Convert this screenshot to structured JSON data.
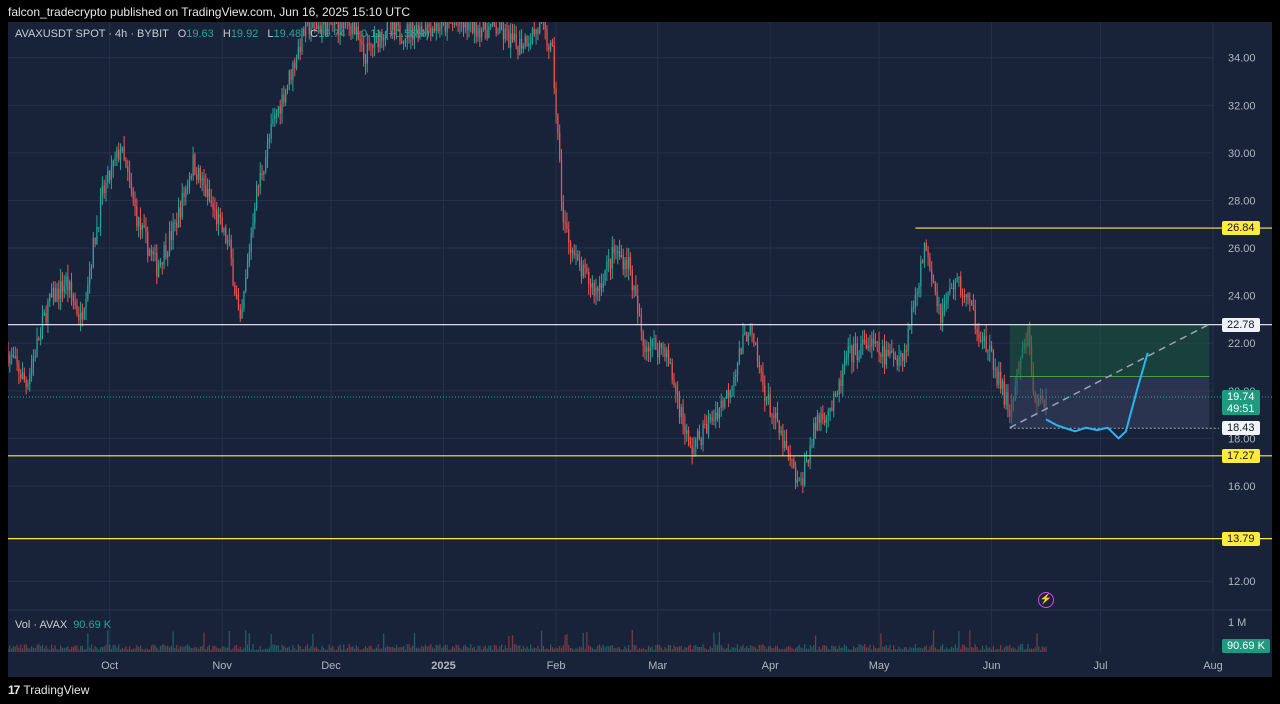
{
  "header": {
    "publisher_line": "falcon_tradecrypto published on TradingView.com, Jun 16, 2025 15:10 UTC"
  },
  "legend": {
    "symbol": "AVAXUSDT SPOT · 4h · BYBIT",
    "open_label": "O",
    "open": "19.63",
    "high_label": "H",
    "high": "19.92",
    "low_label": "L",
    "low": "19.48",
    "close_label": "C",
    "close": "19.74",
    "change": "+0.11 (+0.56%)"
  },
  "volume_legend": {
    "label": "Vol · AVAX",
    "value": "90.69 K",
    "axis_label": "1 M",
    "tag": "90.69 K"
  },
  "footer": {
    "brand": "TradingView",
    "logo": "17"
  },
  "colors": {
    "background": "#18233a",
    "grid": "#25314a",
    "bull": "#26a69a",
    "bear": "#ef5350",
    "level_yellow": "#ffeb3b",
    "level_white": "#f0f3fa",
    "projection": "#29b6f6",
    "target_zone": "#1e5a3f",
    "stop_zone": "#3b4460"
  },
  "chart_data": {
    "type": "candlestick",
    "symbol": "AVAXUSDT",
    "timeframe": "4h",
    "y_axis": {
      "ticks": [
        "12.00",
        "16.00",
        "18.00",
        "20.00",
        "22.00",
        "24.00",
        "26.00",
        "28.00",
        "30.00",
        "32.00",
        "34.00"
      ],
      "ylim": [
        11,
        35.5
      ]
    },
    "x_axis": {
      "ticks": [
        {
          "label": "Oct",
          "date": "2024-10-01"
        },
        {
          "label": "Nov",
          "date": "2024-11-01"
        },
        {
          "label": "Dec",
          "date": "2024-12-01"
        },
        {
          "label": "2025",
          "date": "2025-01-01"
        },
        {
          "label": "Feb",
          "date": "2025-02-01"
        },
        {
          "label": "Mar",
          "date": "2025-03-01"
        },
        {
          "label": "Apr",
          "date": "2025-04-01"
        },
        {
          "label": "May",
          "date": "2025-05-01"
        },
        {
          "label": "Jun",
          "date": "2025-06-01"
        },
        {
          "label": "Jul",
          "date": "2025-07-01"
        },
        {
          "label": "Aug",
          "date": "2025-08-01"
        }
      ],
      "xlim": [
        "2024-09-03",
        "2025-08-01"
      ]
    },
    "price_path": [
      {
        "date": "2024-09-03",
        "price": 21.6
      },
      {
        "date": "2024-09-08",
        "price": 20.3
      },
      {
        "date": "2024-09-14",
        "price": 23.6
      },
      {
        "date": "2024-09-19",
        "price": 24.6
      },
      {
        "date": "2024-09-23",
        "price": 23.0
      },
      {
        "date": "2024-09-29",
        "price": 28.2
      },
      {
        "date": "2024-10-04",
        "price": 30.2
      },
      {
        "date": "2024-10-09",
        "price": 27.0
      },
      {
        "date": "2024-10-14",
        "price": 25.2
      },
      {
        "date": "2024-10-19",
        "price": 26.9
      },
      {
        "date": "2024-10-24",
        "price": 29.6
      },
      {
        "date": "2024-10-29",
        "price": 27.8
      },
      {
        "date": "2024-11-03",
        "price": 26.0
      },
      {
        "date": "2024-11-06",
        "price": 22.6
      },
      {
        "date": "2024-11-10",
        "price": 28.0
      },
      {
        "date": "2024-11-15",
        "price": 31.2
      },
      {
        "date": "2024-11-20",
        "price": 33.4
      },
      {
        "date": "2024-11-24",
        "price": 35.3
      },
      {
        "date": "2024-12-07",
        "price": 35.4
      },
      {
        "date": "2024-12-10",
        "price": 34.0
      },
      {
        "date": "2024-12-16",
        "price": 35.3
      },
      {
        "date": "2024-12-20",
        "price": 35.0
      },
      {
        "date": "2024-12-26",
        "price": 35.3
      },
      {
        "date": "2025-01-05",
        "price": 35.4
      },
      {
        "date": "2025-01-16",
        "price": 35.2
      },
      {
        "date": "2025-01-21",
        "price": 34.5
      },
      {
        "date": "2025-01-28",
        "price": 35.3
      },
      {
        "date": "2025-01-31",
        "price": 34.1
      },
      {
        "date": "2025-02-03",
        "price": 27.1
      },
      {
        "date": "2025-02-07",
        "price": 25.2
      },
      {
        "date": "2025-02-12",
        "price": 24.2
      },
      {
        "date": "2025-02-17",
        "price": 25.8
      },
      {
        "date": "2025-02-21",
        "price": 25.4
      },
      {
        "date": "2025-02-25",
        "price": 22.0
      },
      {
        "date": "2025-03-03",
        "price": 21.8
      },
      {
        "date": "2025-03-10",
        "price": 17.5
      },
      {
        "date": "2025-03-15",
        "price": 18.6
      },
      {
        "date": "2025-03-20",
        "price": 19.8
      },
      {
        "date": "2025-03-26",
        "price": 22.7
      },
      {
        "date": "2025-03-31",
        "price": 19.7
      },
      {
        "date": "2025-04-06",
        "price": 17.2
      },
      {
        "date": "2025-04-09",
        "price": 15.9
      },
      {
        "date": "2025-04-14",
        "price": 18.8
      },
      {
        "date": "2025-04-19",
        "price": 19.5
      },
      {
        "date": "2025-04-22",
        "price": 21.4
      },
      {
        "date": "2025-04-28",
        "price": 22.0
      },
      {
        "date": "2025-05-03",
        "price": 21.4
      },
      {
        "date": "2025-05-08",
        "price": 21.6
      },
      {
        "date": "2025-05-11",
        "price": 24.1
      },
      {
        "date": "2025-05-14",
        "price": 26.2
      },
      {
        "date": "2025-05-18",
        "price": 23.2
      },
      {
        "date": "2025-05-22",
        "price": 24.7
      },
      {
        "date": "2025-05-25",
        "price": 23.9
      },
      {
        "date": "2025-05-29",
        "price": 22.4
      },
      {
        "date": "2025-06-02",
        "price": 20.9
      },
      {
        "date": "2025-06-06",
        "price": 19.1
      },
      {
        "date": "2025-06-09",
        "price": 21.2
      },
      {
        "date": "2025-06-11",
        "price": 22.4
      },
      {
        "date": "2025-06-13",
        "price": 19.4
      },
      {
        "date": "2025-06-16",
        "price": 19.74
      }
    ],
    "horizontal_levels": [
      {
        "price": 26.84,
        "label": "26.84",
        "style": "yellow",
        "from": "2025-05-11"
      },
      {
        "price": 22.78,
        "label": "22.78",
        "style": "white"
      },
      {
        "price": 17.27,
        "label": "17.27",
        "style": "yellow"
      },
      {
        "price": 13.79,
        "label": "13.79",
        "style": "yellow"
      }
    ],
    "long_position": {
      "from": "2025-06-06",
      "to": "2025-07-31",
      "entry": 20.6,
      "target": 22.78,
      "stop": 18.43,
      "stop_label": "18.43"
    },
    "trendline": {
      "start": {
        "date": "2025-06-06",
        "price": 18.45
      },
      "end": {
        "date": "2025-07-31",
        "price": 22.8
      }
    },
    "projection_path": [
      {
        "date": "2025-06-16",
        "price": 18.8
      },
      {
        "date": "2025-06-19",
        "price": 18.55
      },
      {
        "date": "2025-06-24",
        "price": 18.3
      },
      {
        "date": "2025-06-27",
        "price": 18.45
      },
      {
        "date": "2025-06-30",
        "price": 18.35
      },
      {
        "date": "2025-07-03",
        "price": 18.45
      },
      {
        "date": "2025-07-06",
        "price": 18.0
      },
      {
        "date": "2025-07-08",
        "price": 18.3
      },
      {
        "date": "2025-07-11",
        "price": 20.0
      },
      {
        "date": "2025-07-14",
        "price": 21.6
      }
    ],
    "current_price": {
      "value": 19.74,
      "label": "19.74",
      "countdown": "49:51"
    }
  }
}
